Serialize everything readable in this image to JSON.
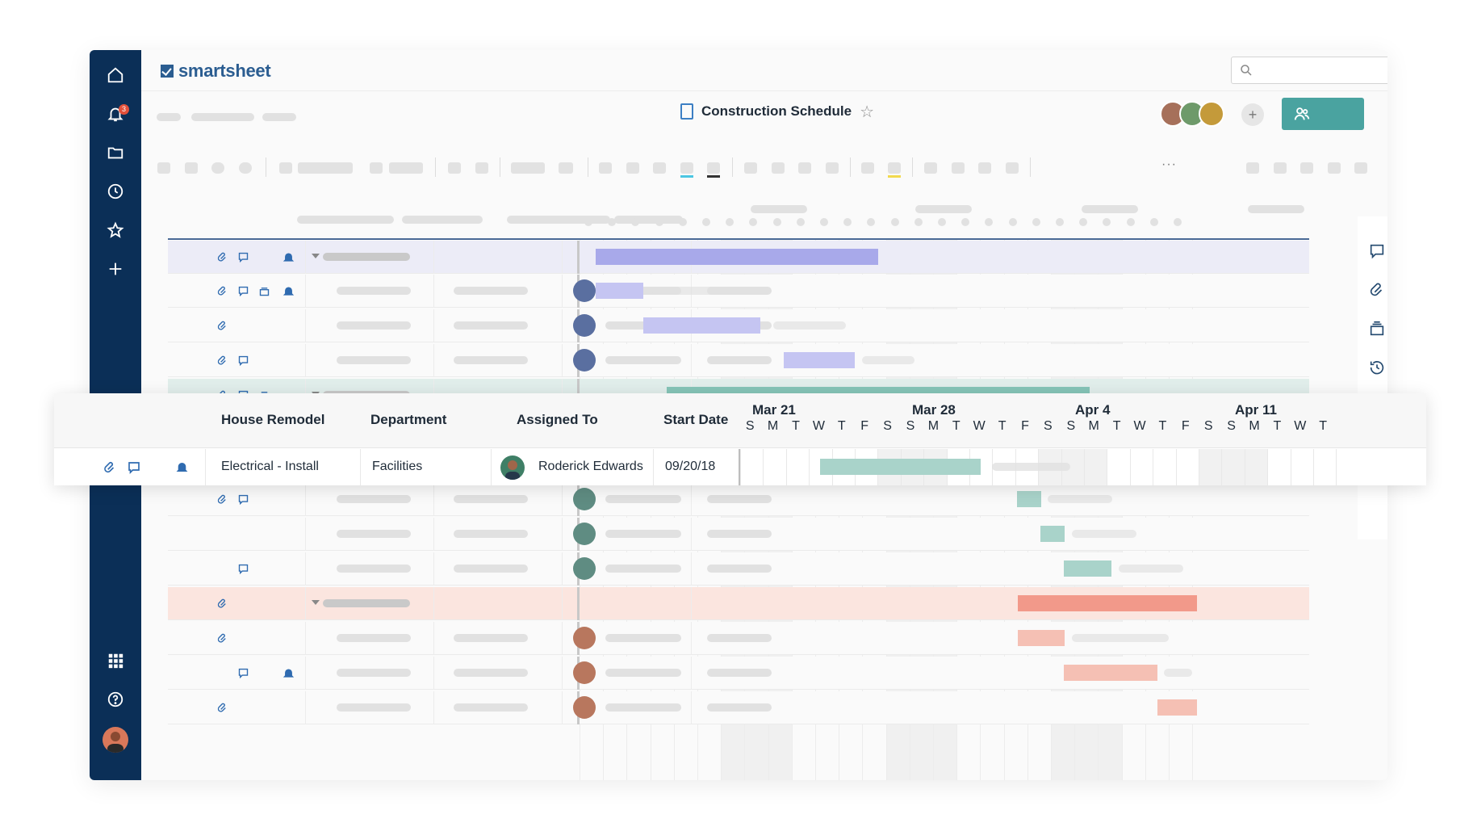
{
  "app": {
    "brand": "smartsheet",
    "notifications_count": "3",
    "sheet_title": "Construction Schedule",
    "search": {
      "placeholder": ""
    },
    "toolbar_more": "···",
    "add_collaborator": "+"
  },
  "sidebar": {
    "items": [
      "home-icon",
      "bell-icon",
      "folder-icon",
      "clock-icon",
      "star-icon",
      "plus-icon",
      "apps-grid-icon",
      "help-icon",
      "avatar"
    ]
  },
  "right_rail": {
    "items": [
      "comment-icon",
      "attachment-icon",
      "proof-icon",
      "activity-log-icon",
      "publish-icon"
    ]
  },
  "columns": {
    "primary": "House Remodel",
    "department": "Department",
    "assigned_to": "Assigned To",
    "start_date": "Start Date"
  },
  "timeline": {
    "months": [
      "Mar 21",
      "Mar 28",
      "Apr 4",
      "Apr 11"
    ],
    "days": [
      "S",
      "M",
      "T",
      "W",
      "T",
      "F",
      "S",
      "S",
      "M",
      "T",
      "W",
      "T",
      "F",
      "S",
      "S",
      "M",
      "T",
      "W",
      "T",
      "F",
      "S",
      "S",
      "M",
      "T",
      "W",
      "T"
    ]
  },
  "highlighted_row": {
    "task": "Electrical - Install",
    "department": "Facilities",
    "assigned_to": "Roderick Edwards",
    "start_date": "09/20/18"
  },
  "colors": {
    "sidebar": "#0b2f57",
    "brand": "#2b5d91",
    "share_button": "#4aa3a0",
    "purple_bar": "#a8a9ea",
    "purple_bar_light": "#c5c5f2",
    "green_bar": "#86c5b8",
    "green_bar_light": "#a9d3ca",
    "orange_bar": "#f2998a",
    "orange_bar_light": "#f5c0b4",
    "purple_row": "#ececf7",
    "green_row": "#e1eeeb",
    "orange_row": "#fbe5df",
    "icon_blue": "#2f6bb0"
  }
}
